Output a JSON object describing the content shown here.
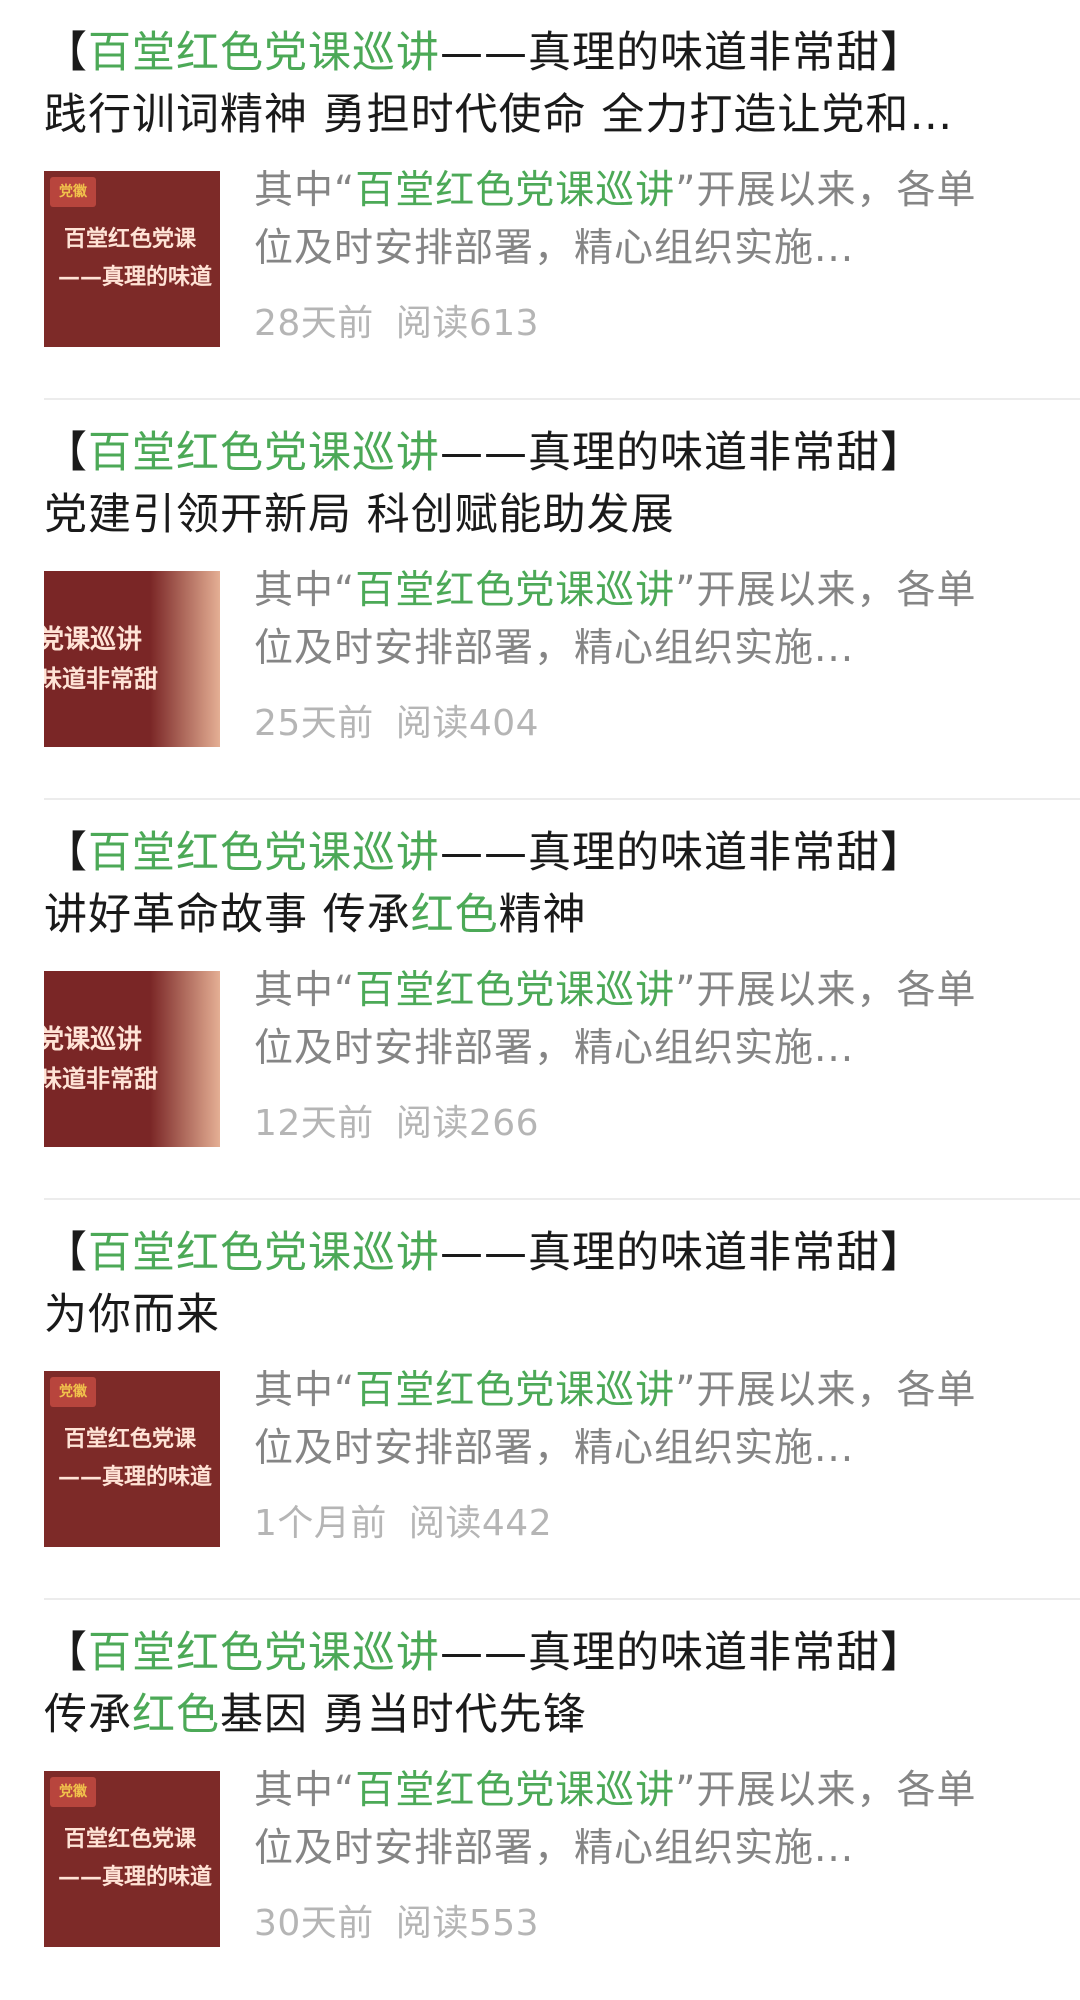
{
  "articles": [
    {
      "title_prefix": "【",
      "title_highlight": "百堂红色党课巡讲",
      "title_suffix": "——真理的味道非常甜】",
      "subtitle_parts": [
        {
          "t": "践行训词精神 勇担时代使命 全力打造让党和…",
          "hl": false
        }
      ],
      "summary_prefix": "其中“",
      "summary_highlight": "百堂红色党课巡讲",
      "summary_suffix": "”开展以来，各单",
      "summary_line2": "位及时安排部署，精心组织实施...",
      "time": "28天前",
      "reads": "阅读613",
      "thumb": {
        "variant": "t1",
        "badge": "党徽",
        "line1": "百堂红色党课",
        "line2": "——真理的味道"
      }
    },
    {
      "title_prefix": "【",
      "title_highlight": "百堂红色党课巡讲",
      "title_suffix": "——真理的味道非常甜】",
      "subtitle_parts": [
        {
          "t": "党建引领开新局 科创赋能助发展",
          "hl": false
        }
      ],
      "summary_prefix": "其中“",
      "summary_highlight": "百堂红色党课巡讲",
      "summary_suffix": "”开展以来，各单",
      "summary_line2": "位及时安排部署，精心组织实施...",
      "time": "25天前",
      "reads": "阅读404",
      "thumb": {
        "variant": "t2",
        "badge": "",
        "line1": "党课巡讲",
        "line2": "味道非常甜"
      }
    },
    {
      "title_prefix": "【",
      "title_highlight": "百堂红色党课巡讲",
      "title_suffix": "——真理的味道非常甜】",
      "subtitle_parts": [
        {
          "t": "讲好革命故事 传承",
          "hl": false
        },
        {
          "t": "红色",
          "hl": true
        },
        {
          "t": "精神",
          "hl": false
        }
      ],
      "summary_prefix": "其中“",
      "summary_highlight": "百堂红色党课巡讲",
      "summary_suffix": "”开展以来，各单",
      "summary_line2": "位及时安排部署，精心组织实施...",
      "time": "12天前",
      "reads": "阅读266",
      "thumb": {
        "variant": "t2",
        "badge": "",
        "line1": "党课巡讲",
        "line2": "味道非常甜"
      }
    },
    {
      "title_prefix": "【",
      "title_highlight": "百堂红色党课巡讲",
      "title_suffix": "——真理的味道非常甜】",
      "subtitle_parts": [
        {
          "t": "为你而来",
          "hl": false
        }
      ],
      "summary_prefix": "其中“",
      "summary_highlight": "百堂红色党课巡讲",
      "summary_suffix": "”开展以来，各单",
      "summary_line2": "位及时安排部署，精心组织实施...",
      "time": "1个月前",
      "reads": "阅读442",
      "thumb": {
        "variant": "t1",
        "badge": "党徽",
        "line1": "百堂红色党课",
        "line2": "——真理的味道"
      }
    },
    {
      "title_prefix": "【",
      "title_highlight": "百堂红色党课巡讲",
      "title_suffix": "——真理的味道非常甜】",
      "subtitle_parts": [
        {
          "t": "传承",
          "hl": false
        },
        {
          "t": "红色",
          "hl": true
        },
        {
          "t": "基因 勇当时代先锋",
          "hl": false
        }
      ],
      "summary_prefix": "其中“",
      "summary_highlight": "百堂红色党课巡讲",
      "summary_suffix": "”开展以来，各单",
      "summary_line2": "位及时安排部署，精心组织实施...",
      "time": "30天前",
      "reads": "阅读553",
      "thumb": {
        "variant": "t1",
        "badge": "党徽",
        "line1": "百堂红色党课",
        "line2": "——真理的味道"
      }
    }
  ],
  "colors": {
    "highlight": "#4ca957",
    "thumb_bg": "#7d2a28",
    "summary": "#858585",
    "meta": "#b5b5b5"
  }
}
